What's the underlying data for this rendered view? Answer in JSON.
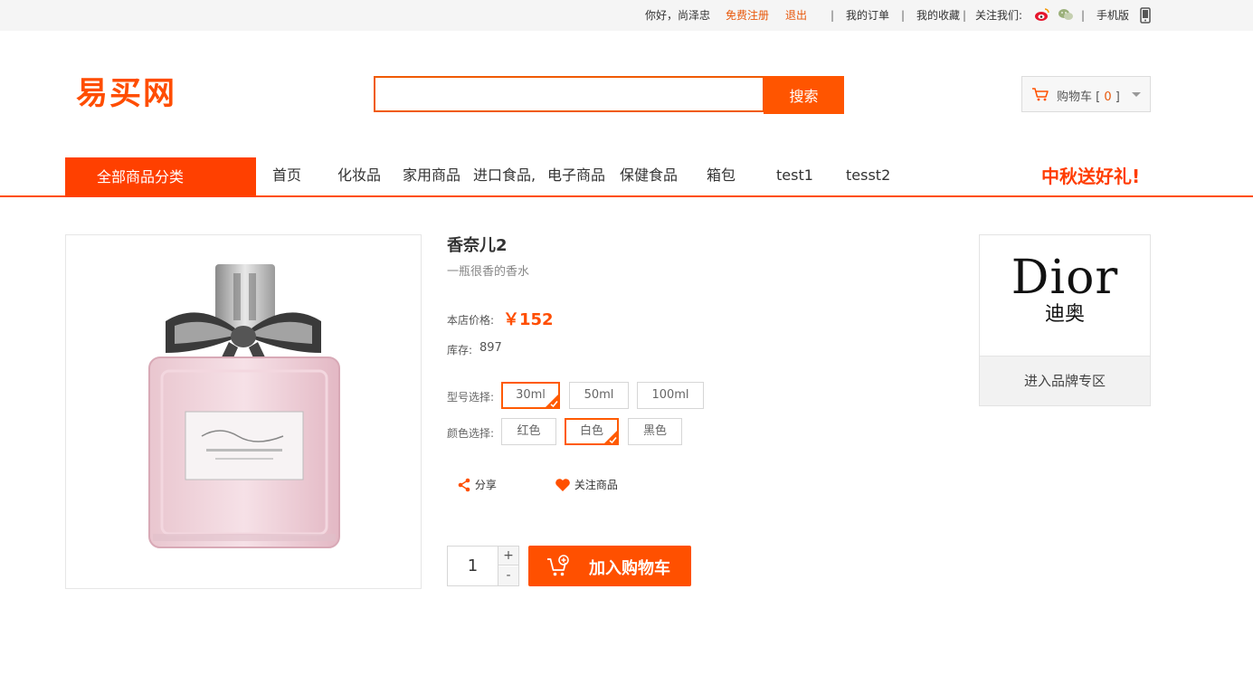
{
  "topbar": {
    "greeting": "你好，尚泽忠",
    "register": "免费注册",
    "logout": "退出",
    "sep": "|",
    "my_orders": "我的订单",
    "my_favorites": "我的收藏",
    "follow_us": "关注我们:",
    "mobile": "手机版"
  },
  "header": {
    "logo": "易买网",
    "search_placeholder": "",
    "search_button": "搜索",
    "cart_label": "购物车",
    "cart_open": "[",
    "cart_count": "0",
    "cart_close": "]"
  },
  "nav": {
    "all_categories": "全部商品分类",
    "links": [
      "首页",
      "化妆品",
      "家用商品",
      "进口食品,",
      "电子商品",
      "保健食品",
      "箱包",
      "test1",
      "tesst2"
    ],
    "promo": "中秋送好礼!"
  },
  "product": {
    "title": "香奈儿2",
    "subtitle": "一瓶很香的香水",
    "price_label": "本店价格:",
    "price": "￥152",
    "stock_label": "库存:",
    "stock": "897",
    "model_label": "型号选择:",
    "models": [
      "30ml",
      "50ml",
      "100ml"
    ],
    "selected_model": "30ml",
    "color_label": "颜色选择:",
    "colors": [
      "红色",
      "白色",
      "黑色"
    ],
    "selected_color": "白色",
    "share": "分享",
    "follow": "关注商品",
    "quantity": "1",
    "plus": "+",
    "minus": "-",
    "add_to_cart": "加入购物车"
  },
  "brand": {
    "name_en": "Dior",
    "name_cn": "迪奥",
    "link": "进入品牌专区"
  },
  "colors": {
    "accent": "#ff5000",
    "nav_accent": "#ff4000",
    "topbar_bg": "#f5f5f5"
  }
}
